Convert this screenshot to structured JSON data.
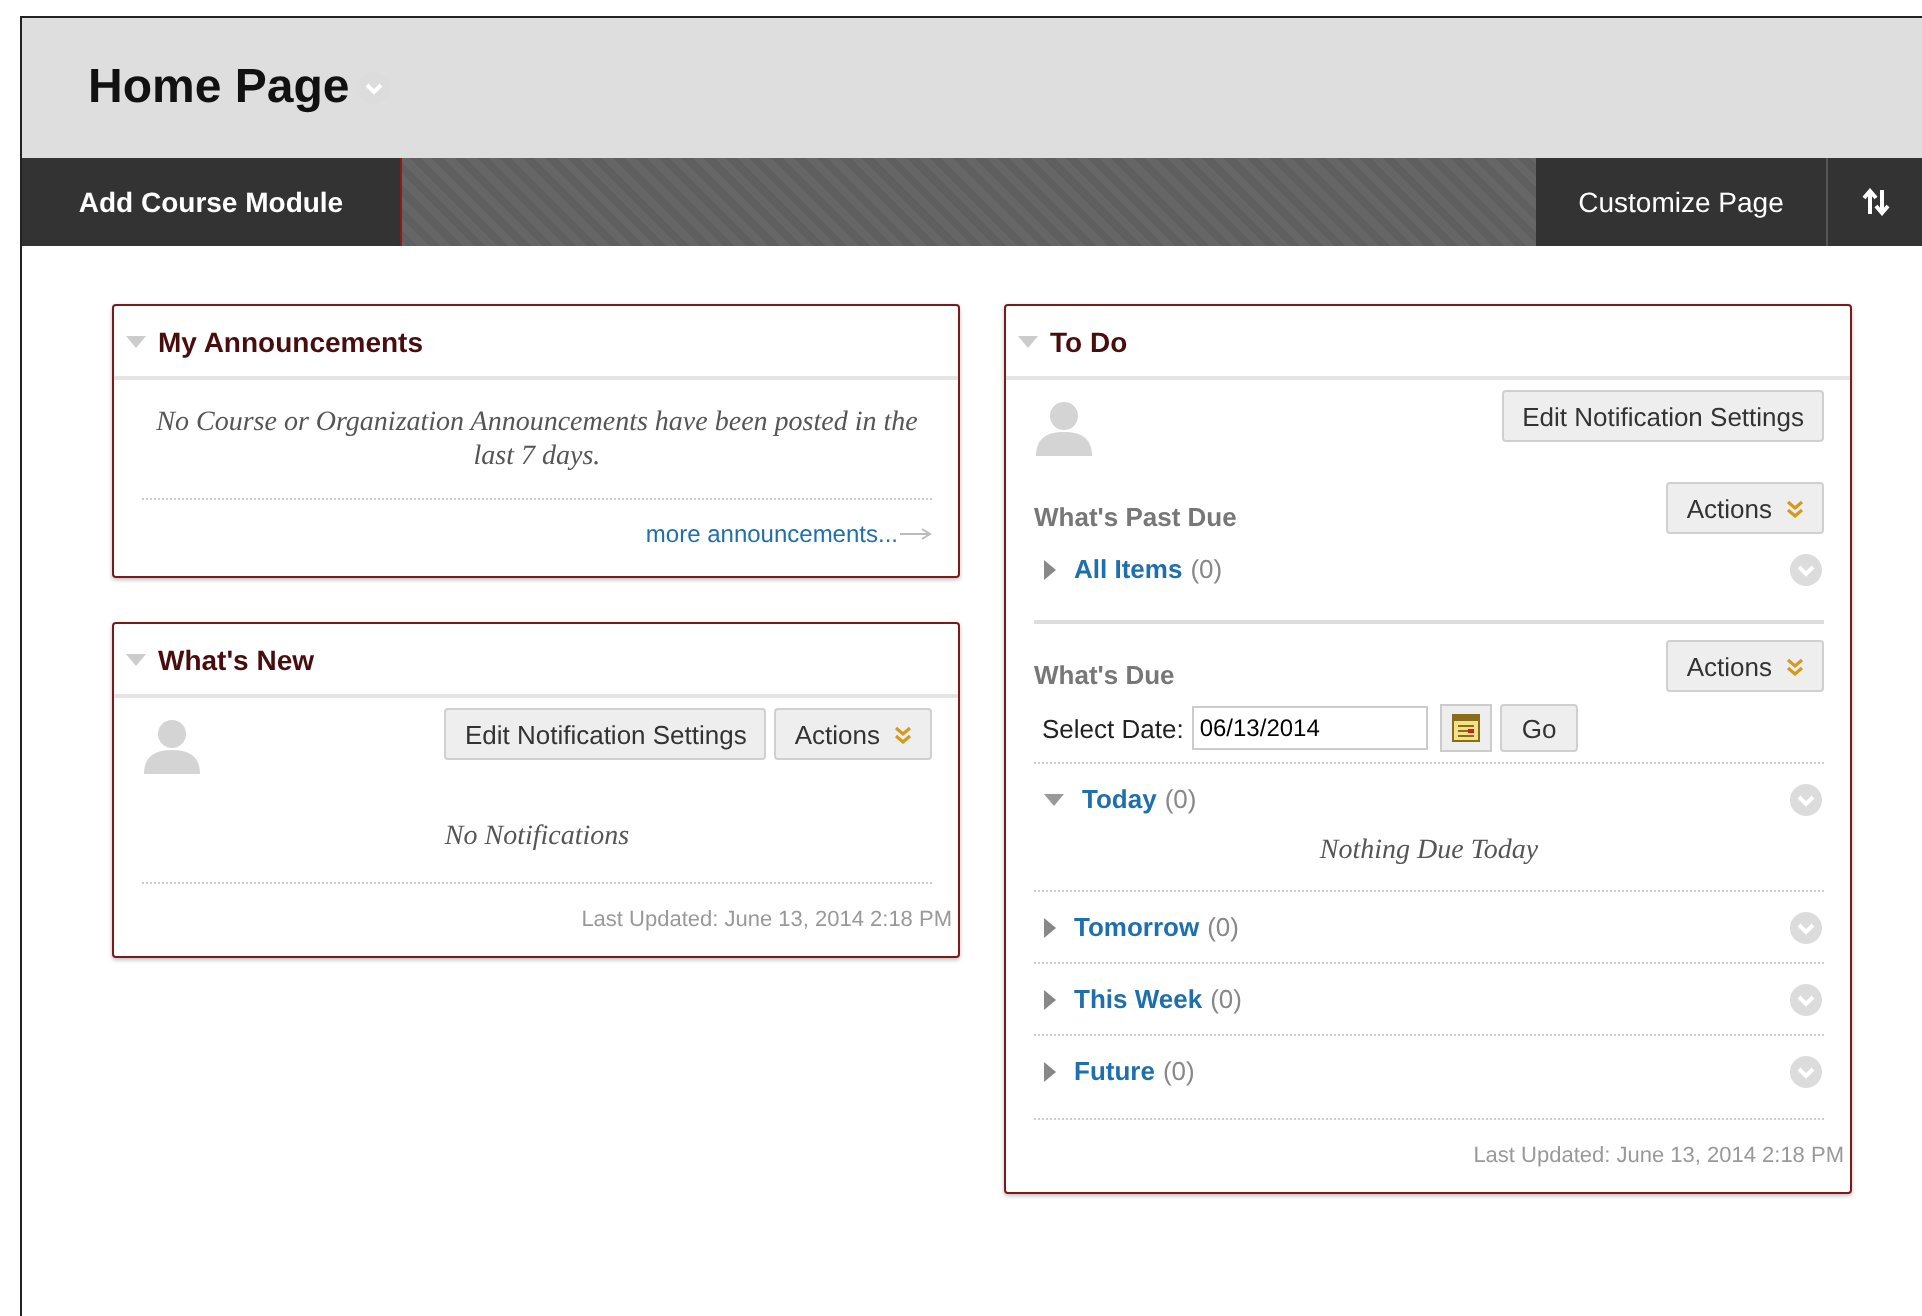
{
  "page": {
    "title": "Home Page"
  },
  "toolbar": {
    "add_button": "Add Course Module",
    "customize_button": "Customize Page"
  },
  "columns": [
    {
      "modules": [
        {
          "kind": "announcements",
          "title": "My Announcements",
          "expanded": true,
          "message": "No Course or Organization Announcements have been posted in the last 7 days.",
          "link": "more announcements..."
        },
        {
          "kind": "whats_new",
          "title": "What's New",
          "expanded": true,
          "buttons": [
            "Edit Notification Settings",
            "Actions"
          ],
          "message": "No Notifications",
          "last_updated": "Last Updated: June 13, 2014 2:18 PM"
        }
      ]
    },
    {
      "modules": [
        {
          "kind": "todo",
          "title": "To Do",
          "expanded": true,
          "edit_button": "Edit Notification Settings",
          "sections": [
            {
              "kind": "past_due",
              "heading": "What's Past Due",
              "actions": "Actions",
              "groups": [
                {
                  "label": "All Items",
                  "count": "(0)",
                  "expanded": false
                }
              ]
            },
            {
              "kind": "due",
              "heading": "What's Due",
              "actions": "Actions",
              "date_label": "Select Date:",
              "date_value": "06/13/2014",
              "go_button": "Go",
              "groups": [
                {
                  "label": "Today",
                  "count": "(0)",
                  "expanded": true,
                  "empty_message": "Nothing Due Today"
                },
                {
                  "label": "Tomorrow",
                  "count": "(0)",
                  "expanded": false
                },
                {
                  "label": "This Week",
                  "count": "(0)",
                  "expanded": false
                },
                {
                  "label": "Future",
                  "count": "(0)",
                  "expanded": false
                }
              ]
            }
          ],
          "last_updated": "Last Updated: June 13, 2014 2:18 PM"
        }
      ]
    }
  ]
}
